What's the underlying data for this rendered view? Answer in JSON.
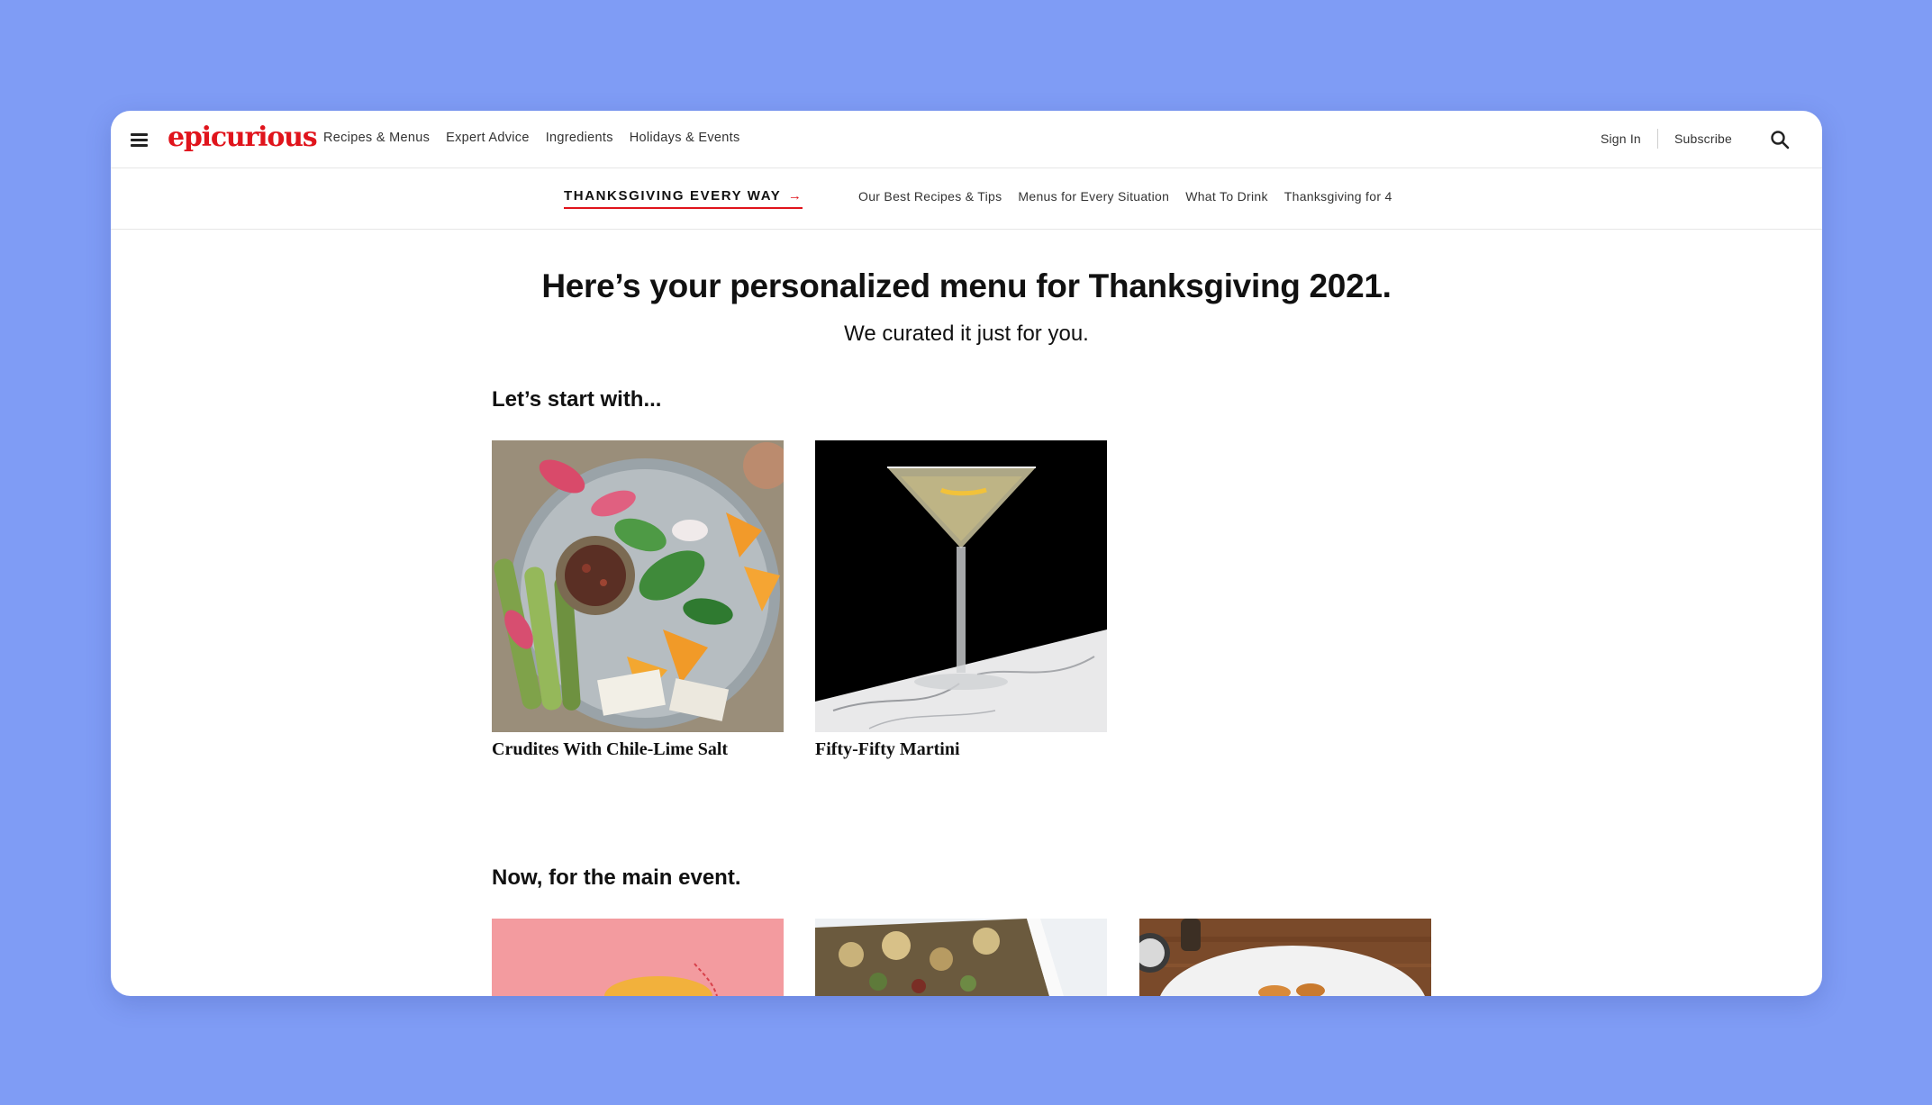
{
  "brand": {
    "logo": "epicurious",
    "accent": "#e0141c",
    "background": "#7f9cf5"
  },
  "topnav": {
    "items": [
      {
        "label": "Recipes & Menus"
      },
      {
        "label": "Expert Advice"
      },
      {
        "label": "Ingredients"
      },
      {
        "label": "Holidays & Events"
      }
    ],
    "sign_in": "Sign In",
    "subscribe": "Subscribe",
    "icons": {
      "menu": "hamburger-menu-icon",
      "search": "search-icon"
    }
  },
  "subnav": {
    "feature": "THANKSGIVING EVERY WAY",
    "feature_arrow": "→",
    "links": [
      {
        "label": "Our Best Recipes & Tips"
      },
      {
        "label": "Menus for Every Situation"
      },
      {
        "label": "What To Drink"
      },
      {
        "label": "Thanksgiving for 4"
      }
    ]
  },
  "hero": {
    "title": "Here’s your personalized menu for Thanksgiving 2021.",
    "subtitle": "We curated it just for you."
  },
  "sections": [
    {
      "title": "Let’s start with...",
      "cards": [
        {
          "title": "Crudites With Chile-Lime Salt",
          "image": "crudites-platter"
        },
        {
          "title": "Fifty-Fifty Martini",
          "image": "martini-glass"
        }
      ]
    },
    {
      "title": "Now, for the main event.",
      "cards": [
        {
          "title": "",
          "image": "pink-dish"
        },
        {
          "title": "",
          "image": "stuffing-pan"
        },
        {
          "title": "",
          "image": "plated-dish-wood"
        }
      ]
    }
  ]
}
